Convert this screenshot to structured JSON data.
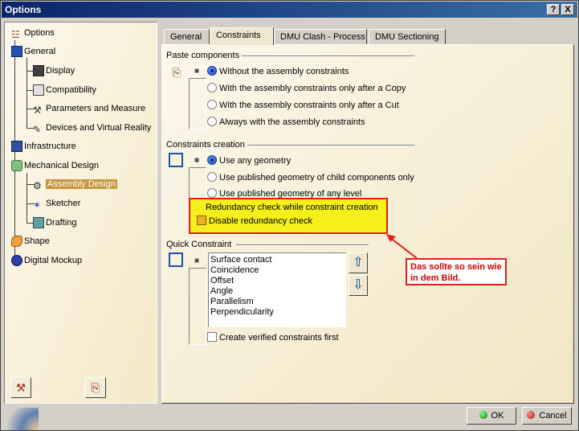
{
  "window": {
    "title": "Options",
    "help_label": "?",
    "close_label": "X"
  },
  "tree": {
    "items": [
      {
        "label": "Options"
      },
      {
        "label": "General"
      },
      {
        "label": "Display"
      },
      {
        "label": "Compatibility"
      },
      {
        "label": "Parameters and Measure"
      },
      {
        "label": "Devices and Virtual Reality"
      },
      {
        "label": "Infrastructure"
      },
      {
        "label": "Mechanical Design"
      },
      {
        "label": "Assembly Design"
      },
      {
        "label": "Sketcher"
      },
      {
        "label": "Drafting"
      },
      {
        "label": "Shape"
      },
      {
        "label": "Digital Mockup"
      }
    ]
  },
  "tabs": [
    {
      "label": "General"
    },
    {
      "label": "Constraints"
    },
    {
      "label": "DMU Clash - Process"
    },
    {
      "label": "DMU Sectioning"
    }
  ],
  "paste": {
    "title": "Paste components",
    "options": [
      {
        "label": "Without the assembly constraints"
      },
      {
        "label": "With the assembly constraints only after a Copy"
      },
      {
        "label": "With the assembly constraints only after a Cut"
      },
      {
        "label": "Always with the assembly constraints"
      }
    ]
  },
  "creation": {
    "title": "Constraints creation",
    "options": [
      {
        "label": "Use any geometry"
      },
      {
        "label": "Use published geometry of child components only"
      },
      {
        "label": "Use published geometry of any level"
      }
    ],
    "redundancy_title": "Redundancy check while constraint creation",
    "redundancy_checkbox": "Disable redundancy check"
  },
  "quick": {
    "title": "Quick Constraint",
    "items": [
      "Surface contact",
      "Coincidence",
      "Offset",
      "Angle",
      "Parallelism",
      "Perpendicularity"
    ],
    "verified_checkbox": "Create verified constraints first"
  },
  "annotation": {
    "text": "Das sollte so sein wie in dem Bild."
  },
  "buttons": {
    "ok": "OK",
    "cancel": "Cancel"
  },
  "colors": {
    "highlight": "#f5ef1c",
    "annotation_red": "#e02020",
    "title_bar": "#0a246a"
  }
}
